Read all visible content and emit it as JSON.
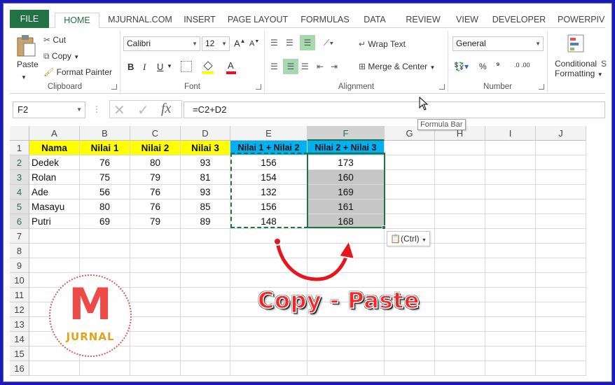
{
  "tabs": [
    "FILE",
    "HOME",
    "MJURNAL.COM",
    "INSERT",
    "PAGE LAYOUT",
    "FORMULAS",
    "DATA",
    "REVIEW",
    "VIEW",
    "DEVELOPER",
    "POWERPIVOT"
  ],
  "ribbon": {
    "clipboard": {
      "paste": "Paste",
      "cut": "Cut",
      "copy": "Copy",
      "format_painter": "Format Painter",
      "label": "Clipboard"
    },
    "font": {
      "name": "Calibri",
      "size": "12",
      "bold": "B",
      "italic": "I",
      "underline": "U",
      "label": "Font"
    },
    "alignment": {
      "wrap": "Wrap Text",
      "merge": "Merge & Center",
      "label": "Alignment"
    },
    "number": {
      "format": "General",
      "percent": "%",
      "comma": "⁹",
      "inc_dec": ".0 .00",
      "label": "Number"
    },
    "styles": {
      "conditional": "Conditional",
      "formatting": "Formatting",
      "extra": "S"
    }
  },
  "formula_bar": {
    "name_box": "F2",
    "fx": "fx",
    "formula": "=C2+D2",
    "tooltip": "Formula Bar"
  },
  "columns": [
    "A",
    "B",
    "C",
    "D",
    "E",
    "F",
    "G",
    "H",
    "I",
    "J"
  ],
  "rows": [
    "1",
    "2",
    "3",
    "4",
    "5",
    "6",
    "7",
    "8",
    "9",
    "10",
    "11",
    "12",
    "13",
    "14",
    "15",
    "16"
  ],
  "headers": [
    "Nama",
    "Nilai 1",
    "Nilai 2",
    "Nilai 3",
    "Nilai 1 + Nilai 2",
    "Nilai 2 + Nilai 3"
  ],
  "table": [
    [
      "Dedek",
      "76",
      "80",
      "93",
      "156",
      "173"
    ],
    [
      "Rolan",
      "75",
      "79",
      "81",
      "154",
      "160"
    ],
    [
      "Ade",
      "56",
      "76",
      "93",
      "132",
      "169"
    ],
    [
      "Masayu",
      "80",
      "76",
      "85",
      "156",
      "161"
    ],
    [
      "Putri",
      "69",
      "79",
      "89",
      "148",
      "168"
    ]
  ],
  "paste_options": "(Ctrl)",
  "logo": {
    "letter": "M",
    "text": "JURNAL"
  },
  "caption": "Copy - Paste",
  "colors": {
    "excel_green": "#217346",
    "header_yellow": "#ffff00",
    "header_blue": "#00b0f0",
    "caption_red": "#ff2222"
  }
}
